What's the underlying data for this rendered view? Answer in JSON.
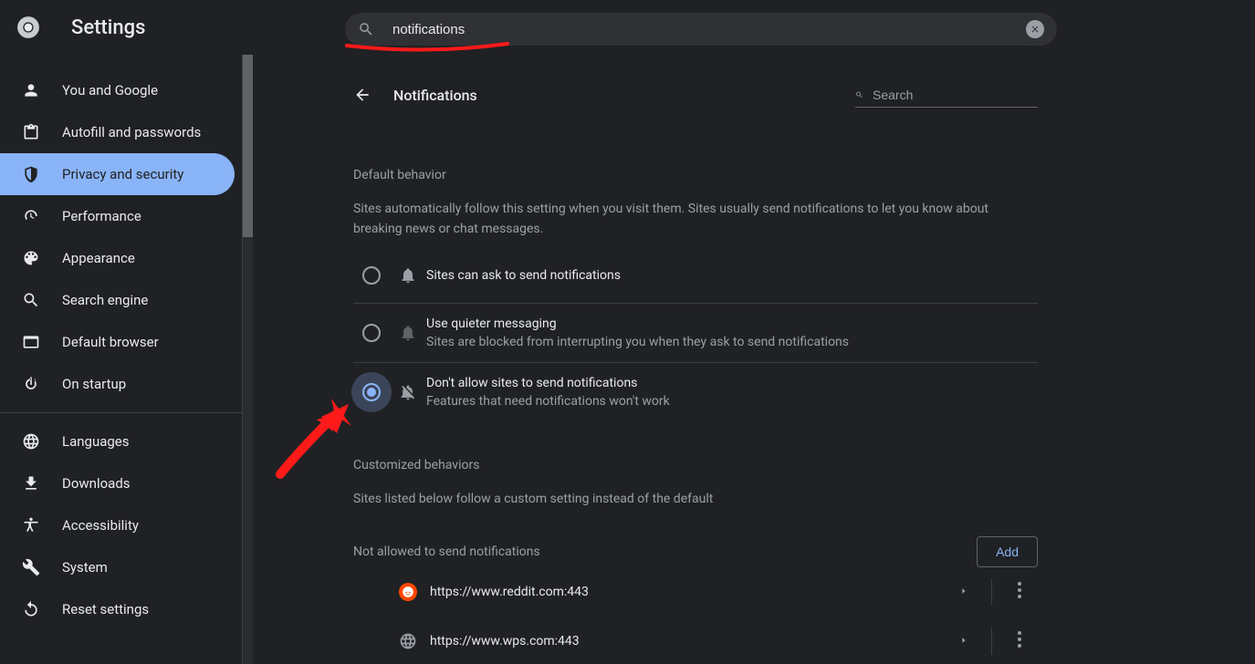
{
  "app": {
    "title": "Settings"
  },
  "topSearch": {
    "value": "notifications"
  },
  "sidebar": {
    "groups": [
      [
        {
          "label": "You and Google"
        },
        {
          "label": "Autofill and passwords"
        },
        {
          "label": "Privacy and security"
        },
        {
          "label": "Performance"
        },
        {
          "label": "Appearance"
        },
        {
          "label": "Search engine"
        },
        {
          "label": "Default browser"
        },
        {
          "label": "On startup"
        }
      ],
      [
        {
          "label": "Languages"
        },
        {
          "label": "Downloads"
        },
        {
          "label": "Accessibility"
        },
        {
          "label": "System"
        },
        {
          "label": "Reset settings"
        }
      ]
    ]
  },
  "page": {
    "title": "Notifications",
    "searchPlaceholder": "Search",
    "defaultBehavior": {
      "heading": "Default behavior",
      "desc": "Sites automatically follow this setting when you visit them. Sites usually send notifications to let you know about breaking news or chat messages.",
      "options": [
        {
          "title": "Sites can ask to send notifications",
          "sub": ""
        },
        {
          "title": "Use quieter messaging",
          "sub": "Sites are blocked from interrupting you when they ask to send notifications"
        },
        {
          "title": "Don't allow sites to send notifications",
          "sub": "Features that need notifications won't work"
        }
      ]
    },
    "customized": {
      "heading": "Customized behaviors",
      "desc": "Sites listed below follow a custom setting instead of the default"
    },
    "notAllowed": {
      "heading": "Not allowed to send notifications",
      "add": "Add",
      "sites": [
        {
          "url": "https://www.reddit.com:443",
          "faviconColor": "#ff4500"
        },
        {
          "url": "https://www.wps.com:443",
          "faviconColor": "#9aa0a6"
        }
      ]
    }
  }
}
